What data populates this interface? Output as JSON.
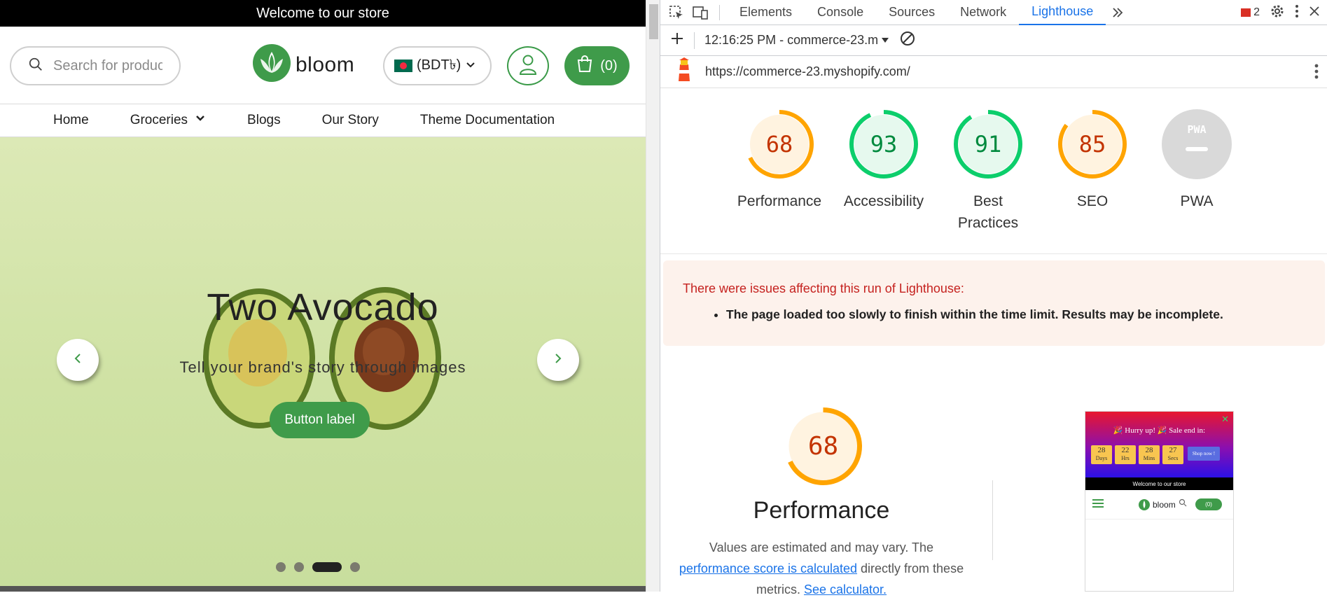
{
  "store": {
    "announcement": "Welcome to our store",
    "search_placeholder": "Search for produc",
    "logo_text": "bloom",
    "currency_label": "(BDT৳)",
    "cart_count": "(0)",
    "nav": [
      "Home",
      "Groceries",
      "Blogs",
      "Our Story",
      "Theme Documentation"
    ],
    "hero": {
      "title": "Two Avocado",
      "subtitle": "Tell your brand's story through images",
      "button_label": "Button label",
      "slide_count": 4,
      "active_slide": 3
    },
    "brand_color": "#3f9b4a"
  },
  "devtools": {
    "tabs": [
      "Elements",
      "Console",
      "Sources",
      "Network",
      "Lighthouse"
    ],
    "active_tab": "Lighthouse",
    "error_count": "2",
    "report_time": "12:16:25 PM - commerce-23.m",
    "url": "https://commerce-23.myshopify.com/",
    "scores": [
      {
        "name": "Performance",
        "value": "68",
        "level": "average"
      },
      {
        "name": "Accessibility",
        "value": "93",
        "level": "pass"
      },
      {
        "name": "Best Practices",
        "value": "91",
        "level": "pass"
      },
      {
        "name": "SEO",
        "value": "85",
        "level": "average"
      },
      {
        "name": "PWA",
        "value": "",
        "level": "na"
      }
    ],
    "pwa_badge": "PWA",
    "issues": {
      "heading": "There were issues affecting this run of Lighthouse:",
      "items": [
        "The page loaded too slowly to finish within the time limit. Results may be incomplete."
      ]
    },
    "performance": {
      "score": "68",
      "title": "Performance",
      "desc_pre": "Values are estimated and may vary. The ",
      "desc_link": "performance score is calculated",
      "desc_mid": " directly from these metrics. ",
      "desc_link2": "See calculator."
    },
    "screenshot": {
      "hurry": "🎉 Hurry up! 🎉  Sale end in:",
      "counters": [
        {
          "value": "28",
          "unit": "Days"
        },
        {
          "value": "22",
          "unit": "Hrs"
        },
        {
          "value": "28",
          "unit": "Mins"
        },
        {
          "value": "27",
          "unit": "Secs"
        }
      ],
      "shop_button": "Shop now !",
      "welcome": "Welcome to our store",
      "logo": "bloom",
      "cart": "(0)"
    },
    "colors": {
      "pass": "#0cce6b",
      "average": "#ffa400",
      "fail": "#ff4e42",
      "accent": "#1a73e8"
    }
  }
}
